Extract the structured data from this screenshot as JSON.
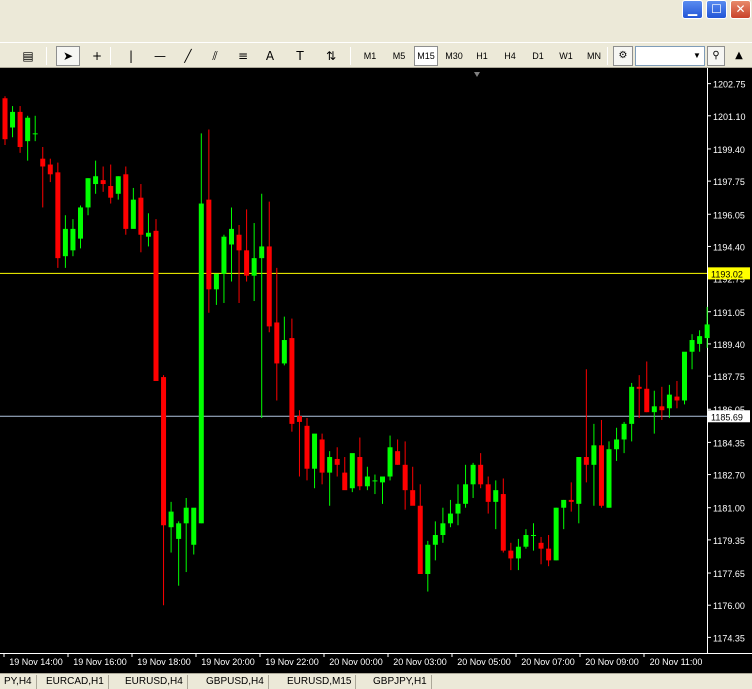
{
  "window": {
    "minimize_glyph": "▁",
    "maximize_glyph": "☐",
    "close_glyph": "✕"
  },
  "toolbar": {
    "tools": [
      {
        "name": "chart-type-icon",
        "glyph": "▤"
      },
      {
        "name": "cursor-icon",
        "glyph": "➤"
      },
      {
        "name": "crosshair-icon",
        "glyph": "+"
      },
      {
        "name": "vertical-line-icon",
        "glyph": "|"
      },
      {
        "name": "horizontal-line-icon",
        "glyph": "—"
      },
      {
        "name": "trendline-icon",
        "glyph": "╱"
      },
      {
        "name": "equidistant-channel-icon",
        "glyph": "⫽"
      },
      {
        "name": "fibonacci-icon",
        "glyph": "≡"
      },
      {
        "name": "text-icon",
        "glyph": "A"
      },
      {
        "name": "text-label-icon",
        "glyph": "T"
      },
      {
        "name": "arrows-icon",
        "glyph": "⇅"
      }
    ],
    "timeframes": [
      "M1",
      "M5",
      "M15",
      "M30",
      "H1",
      "H4",
      "D1",
      "W1",
      "MN"
    ],
    "active_timeframe": "M15",
    "combo_value": "",
    "combo_arrow": "▼",
    "settings_glyph": "⚙",
    "search_glyph": "⚲",
    "scroll_glyph": "▲"
  },
  "chart_data": {
    "type": "candlestick",
    "price_labels": [
      "1202.75",
      "1201.10",
      "1199.40",
      "1197.75",
      "1196.05",
      "1194.40",
      "1192.75",
      "1191.05",
      "1189.40",
      "1187.75",
      "1186.05",
      "1184.35",
      "1182.70",
      "1181.00",
      "1179.35",
      "1177.65",
      "1176.00",
      "1174.35"
    ],
    "current_price": "1193.02",
    "reference_price": "1185.69",
    "time_labels": [
      "19 Nov 14:00",
      "19 Nov 16:00",
      "19 Nov 18:00",
      "19 Nov 20:00",
      "19 Nov 22:00",
      "20 Nov 00:00",
      "20 Nov 03:00",
      "20 Nov 05:00",
      "20 Nov 07:00",
      "20 Nov 09:00",
      "20 Nov 11:00"
    ],
    "colors": {
      "bull": "#00ff00",
      "bear": "#ff0000",
      "background": "#000000",
      "axis": "#ffffff",
      "current_line": "#ffff00",
      "ref_line": "#b0c4de"
    },
    "candles": [
      [
        1202.0,
        1202.1,
        1199.6,
        1199.9
      ],
      [
        1200.5,
        1201.6,
        1200.0,
        1201.3
      ],
      [
        1201.3,
        1201.6,
        1199.2,
        1199.5
      ],
      [
        1199.8,
        1201.1,
        1198.8,
        1201.0
      ],
      [
        1200.2,
        1201.1,
        1199.8,
        1200.2
      ],
      [
        1198.9,
        1199.5,
        1196.4,
        1198.5
      ],
      [
        1198.6,
        1198.9,
        1197.7,
        1198.1
      ],
      [
        1198.2,
        1198.7,
        1193.3,
        1193.8
      ],
      [
        1193.9,
        1196.0,
        1193.3,
        1195.3
      ],
      [
        1194.2,
        1195.8,
        1193.9,
        1195.3
      ],
      [
        1194.8,
        1196.5,
        1194.3,
        1196.4
      ],
      [
        1196.4,
        1197.9,
        1196.0,
        1197.9
      ],
      [
        1197.6,
        1198.8,
        1197.1,
        1198.0
      ],
      [
        1197.8,
        1198.5,
        1197.2,
        1197.6
      ],
      [
        1197.5,
        1198.6,
        1196.6,
        1196.9
      ],
      [
        1197.1,
        1198.0,
        1196.8,
        1198.0
      ],
      [
        1198.1,
        1198.5,
        1195.0,
        1195.3
      ],
      [
        1195.3,
        1197.4,
        1196.4,
        1196.8
      ],
      [
        1196.9,
        1197.6,
        1194.1,
        1195.0
      ],
      [
        1194.9,
        1196.1,
        1194.4,
        1195.1
      ],
      [
        1195.2,
        1195.8,
        1187.7,
        1187.5
      ],
      [
        1187.7,
        1187.8,
        1176.0,
        1180.1
      ],
      [
        1180.0,
        1181.3,
        1178.7,
        1180.8
      ],
      [
        1179.4,
        1180.3,
        1177.0,
        1180.2
      ],
      [
        1180.2,
        1181.5,
        1177.7,
        1181.0
      ],
      [
        1179.1,
        1180.1,
        1178.6,
        1181.0
      ],
      [
        1180.2,
        1200.2,
        1180.2,
        1196.6
      ],
      [
        1196.8,
        1200.4,
        1191.0,
        1192.2
      ],
      [
        1192.2,
        1192.3,
        1191.4,
        1193.0
      ],
      [
        1193.0,
        1195.0,
        1191.5,
        1194.9
      ],
      [
        1194.5,
        1196.4,
        1192.6,
        1195.3
      ],
      [
        1195.0,
        1195.5,
        1191.5,
        1194.2
      ],
      [
        1194.2,
        1196.3,
        1192.6,
        1192.9
      ],
      [
        1192.9,
        1195.6,
        1191.6,
        1193.8
      ],
      [
        1193.8,
        1197.1,
        1185.6,
        1194.4
      ],
      [
        1194.4,
        1196.7,
        1190.0,
        1190.3
      ],
      [
        1190.5,
        1193.3,
        1186.5,
        1188.4
      ],
      [
        1188.4,
        1190.8,
        1188.3,
        1189.6
      ],
      [
        1189.7,
        1190.7,
        1184.9,
        1185.3
      ],
      [
        1185.7,
        1186.0,
        1182.6,
        1185.4
      ],
      [
        1185.2,
        1185.6,
        1182.4,
        1183.0
      ],
      [
        1183.0,
        1184.6,
        1182.0,
        1184.8
      ],
      [
        1184.5,
        1184.8,
        1182.2,
        1182.8
      ],
      [
        1182.8,
        1183.9,
        1181.1,
        1183.6
      ],
      [
        1183.5,
        1184.1,
        1182.6,
        1183.2
      ],
      [
        1182.8,
        1183.6,
        1182.0,
        1181.9
      ],
      [
        1182.0,
        1183.3,
        1181.8,
        1183.8
      ],
      [
        1183.6,
        1184.6,
        1181.9,
        1182.1
      ],
      [
        1182.1,
        1183.1,
        1181.9,
        1182.6
      ],
      [
        1182.4,
        1182.7,
        1181.7,
        1182.4
      ],
      [
        1182.3,
        1182.5,
        1181.2,
        1182.6
      ],
      [
        1182.6,
        1184.7,
        1182.4,
        1184.1
      ],
      [
        1183.9,
        1184.5,
        1183.2,
        1183.2
      ],
      [
        1183.2,
        1184.4,
        1180.9,
        1181.9
      ],
      [
        1181.9,
        1183.1,
        1181.4,
        1181.1
      ],
      [
        1181.1,
        1182.2,
        1179.6,
        1177.6
      ],
      [
        1177.6,
        1179.3,
        1176.7,
        1179.1
      ],
      [
        1179.1,
        1180.3,
        1178.3,
        1179.6
      ],
      [
        1179.6,
        1181.0,
        1179.2,
        1180.2
      ],
      [
        1180.2,
        1181.4,
        1180.0,
        1180.7
      ],
      [
        1180.7,
        1182.2,
        1180.1,
        1181.2
      ],
      [
        1181.2,
        1183.2,
        1181.0,
        1182.2
      ],
      [
        1182.2,
        1183.3,
        1181.5,
        1183.2
      ],
      [
        1183.2,
        1183.8,
        1182.0,
        1182.2
      ],
      [
        1182.2,
        1182.6,
        1180.7,
        1181.3
      ],
      [
        1181.3,
        1182.4,
        1179.9,
        1181.9
      ],
      [
        1181.7,
        1182.5,
        1178.7,
        1178.8
      ],
      [
        1178.8,
        1179.2,
        1177.8,
        1178.4
      ],
      [
        1178.4,
        1179.4,
        1177.8,
        1179.0
      ],
      [
        1179.0,
        1179.9,
        1178.9,
        1179.6
      ],
      [
        1179.6,
        1180.2,
        1178.8,
        1179.6
      ],
      [
        1179.2,
        1179.5,
        1178.1,
        1178.9
      ],
      [
        1178.9,
        1179.6,
        1178.0,
        1178.3
      ],
      [
        1178.3,
        1181.0,
        1178.3,
        1181.0
      ],
      [
        1181.0,
        1181.4,
        1179.9,
        1181.4
      ],
      [
        1181.4,
        1182.3,
        1180.8,
        1181.3
      ],
      [
        1181.2,
        1181.8,
        1180.2,
        1183.6
      ],
      [
        1183.6,
        1188.1,
        1182.3,
        1183.2
      ],
      [
        1183.2,
        1185.3,
        1181.1,
        1184.2
      ],
      [
        1184.2,
        1185.5,
        1181.0,
        1181.1
      ],
      [
        1181.0,
        1184.4,
        1181.0,
        1184.0
      ],
      [
        1184.0,
        1185.1,
        1183.4,
        1184.5
      ],
      [
        1184.5,
        1185.4,
        1183.8,
        1185.3
      ],
      [
        1185.3,
        1187.4,
        1184.4,
        1187.2
      ],
      [
        1187.2,
        1187.8,
        1185.6,
        1187.1
      ],
      [
        1187.1,
        1188.5,
        1185.9,
        1185.9
      ],
      [
        1185.9,
        1187.0,
        1184.8,
        1186.2
      ],
      [
        1186.2,
        1187.2,
        1185.5,
        1186.0
      ],
      [
        1186.1,
        1187.3,
        1185.6,
        1186.8
      ],
      [
        1186.7,
        1187.5,
        1186.1,
        1186.5
      ],
      [
        1186.5,
        1188.8,
        1186.3,
        1189.0
      ],
      [
        1189.0,
        1189.9,
        1188.1,
        1189.6
      ],
      [
        1189.4,
        1190.1,
        1189.0,
        1189.8
      ],
      [
        1189.7,
        1191.3,
        1189.2,
        1190.4
      ]
    ]
  },
  "tabs": [
    "PY,H4",
    "EURCAD,H1",
    "EURUSD,H4",
    "GBPUSD,H4",
    "EURUSD,M15",
    "GBPJPY,H1"
  ],
  "active_tab": "EURUSD,M15"
}
